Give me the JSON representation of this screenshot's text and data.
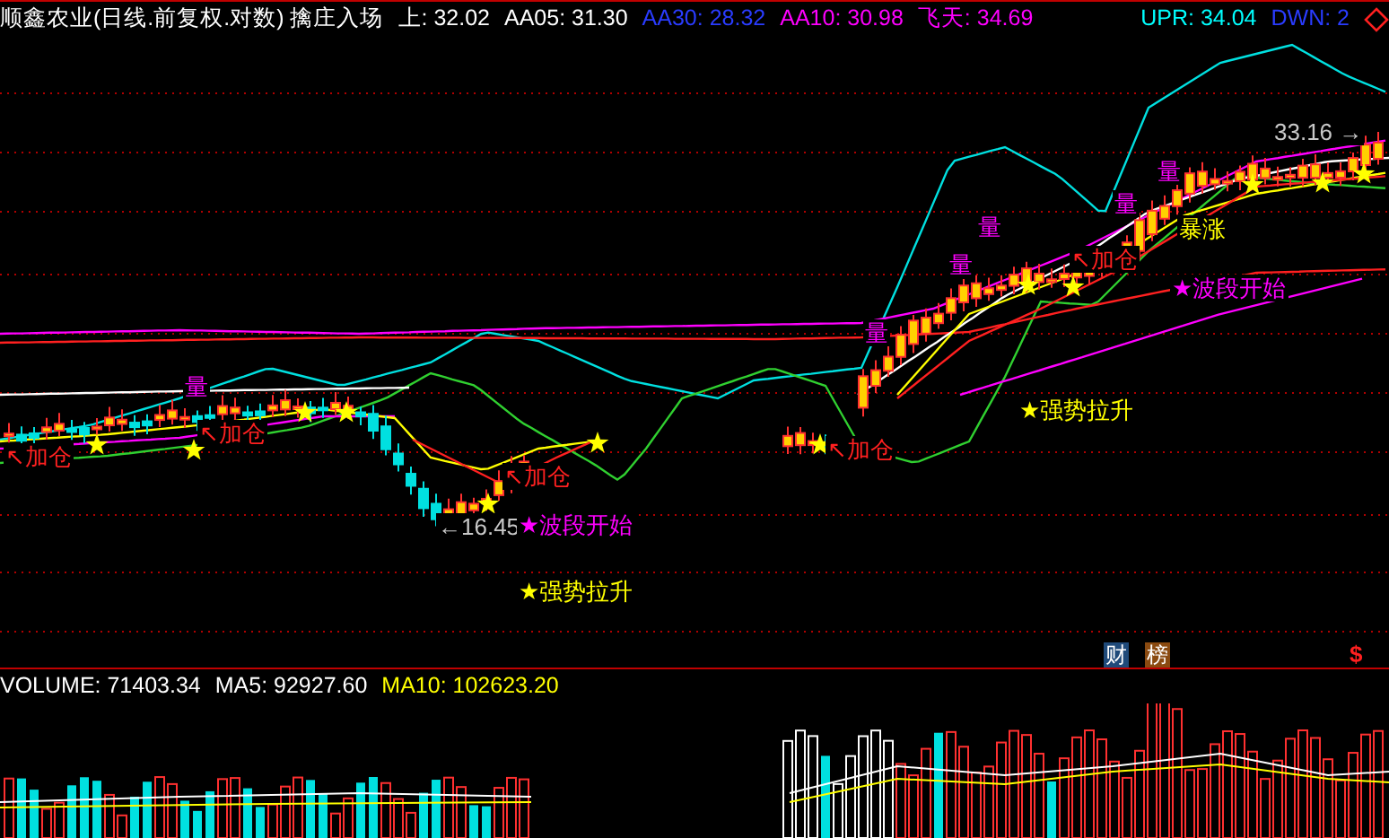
{
  "header": {
    "title": "顺鑫农业(日线.前复权.对数) 擒庄入场",
    "indicators": [
      {
        "text": "上: 32.02",
        "color": "#ffffff"
      },
      {
        "text": "AA05: 31.30",
        "color": "#ffffff"
      },
      {
        "text": "AA30: 28.32",
        "color": "#2a3cff"
      },
      {
        "text": "AA10: 30.98",
        "color": "#ff00ff"
      },
      {
        "text": "飞天: 34.69",
        "color": "#ff00ff"
      },
      {
        "text": "UPR: 34.04",
        "color": "#00ffff"
      },
      {
        "text": "DWN: 2",
        "color": "#2a3cff"
      }
    ]
  },
  "price_chart": {
    "annotations": [
      {
        "kind": "price-marker",
        "text": "33.16 →"
      },
      {
        "kind": "volume-mark",
        "text": "量"
      },
      {
        "kind": "volume-mark",
        "text": "量"
      },
      {
        "kind": "volume-mark",
        "text": "量"
      },
      {
        "kind": "surge",
        "text": "暴涨"
      },
      {
        "kind": "add-position",
        "text": "↖加仓"
      },
      {
        "kind": "volume-mark",
        "text": "量"
      },
      {
        "kind": "wave-start",
        "text": "★波段开始"
      },
      {
        "kind": "volume-mark",
        "text": "量"
      },
      {
        "kind": "volume-mark",
        "text": "量"
      },
      {
        "kind": "strong-rise",
        "text": "★强势拉升"
      },
      {
        "kind": "add-position",
        "text": "↖加仓"
      },
      {
        "kind": "add-position",
        "text": "↖加仓"
      },
      {
        "kind": "add-position",
        "text": "↖加仓"
      },
      {
        "kind": "add-position",
        "text": "↖加仓"
      },
      {
        "kind": "price-marker",
        "text": "←16.45"
      },
      {
        "kind": "wave-start",
        "text": "★波段开始"
      },
      {
        "kind": "strong-rise",
        "text": "★强势拉升"
      }
    ],
    "badges": [
      {
        "text": "财",
        "color": "#1f4a7a"
      },
      {
        "text": "榜",
        "color": "#8a4a10"
      }
    ],
    "dollar_mark": "$"
  },
  "volume_panel": {
    "indicators": [
      {
        "text": "VOLUME: 71403.34",
        "color": "#ffffff"
      },
      {
        "text": "MA5: 92927.60",
        "color": "#ffffff"
      },
      {
        "text": "MA10: 102623.20",
        "color": "#ffff00"
      }
    ]
  }
}
